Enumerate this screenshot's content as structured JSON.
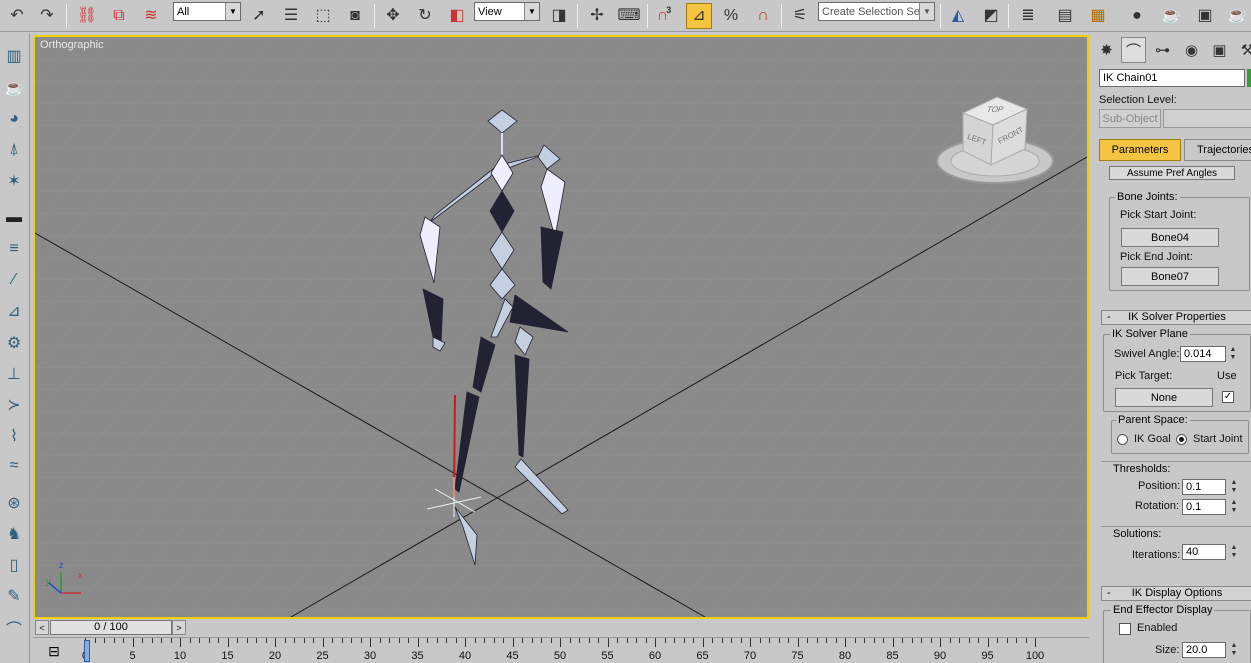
{
  "toolbar": {
    "selection_filter": "All",
    "reference_coord": "View",
    "snap_count": "3",
    "named_selection_placeholder": "Create Selection Set",
    "icons": [
      "undo-icon",
      "redo-icon",
      "select-and-link-icon",
      "unlink-icon",
      "bind-space-warp-icon",
      "select-object-icon",
      "select-by-name-icon",
      "rect-selection-icon",
      "window-crossing-icon",
      "move-icon",
      "rotate-icon",
      "scale-icon",
      "pivot-icon",
      "manipulate-icon",
      "keyboard-shortcut-icon",
      "snaps-toggle-icon",
      "angle-snap-icon",
      "percent-snap-icon",
      "spinner-snap-icon",
      "edit-named-selections-icon",
      "mirror-icon",
      "align-icon",
      "layer-manager-icon",
      "curve-editor-icon",
      "schematic-view-icon",
      "material-editor-icon",
      "render-setup-icon",
      "rendered-frame-icon",
      "render-icon"
    ]
  },
  "viewport": {
    "label": "Orthographic",
    "viewcube": {
      "top": "TOP",
      "left": "LEFT",
      "front": "FRONT"
    },
    "axis": {
      "x": "x",
      "y": "y",
      "z": "z"
    }
  },
  "timeline": {
    "slider_text": "0 / 100",
    "prev": "<",
    "next": ">",
    "ticks": [
      0,
      5,
      10,
      15,
      20,
      25,
      30,
      35,
      40,
      45,
      50,
      55,
      60,
      65,
      70,
      75,
      80,
      85,
      90,
      95,
      100
    ]
  },
  "panel": {
    "object_name": "IK Chain01",
    "object_color": "#3a9a3a",
    "selection_level_label": "Selection Level:",
    "subobject_button": "Sub-Object",
    "tabs": {
      "parameters": "Parameters",
      "trajectories": "Trajectories"
    },
    "assume_pref_angles": "Assume Pref Angles",
    "bone_joints": {
      "title": "Bone Joints:",
      "pick_start_label": "Pick Start Joint:",
      "start_joint": "Bone04",
      "pick_end_label": "Pick End Joint:",
      "end_joint": "Bone07"
    },
    "ik_solver": {
      "rollout_title": "IK Solver Properties",
      "minus": "-",
      "plane_title": "IK Solver Plane",
      "swivel_label": "Swivel Angle:",
      "swivel_value": "0.014",
      "pick_target_label": "Pick Target:",
      "use_label": "Use",
      "target_button": "None",
      "use_checked": "✓",
      "parent_space_title": "Parent Space:",
      "ik_goal": "IK Goal",
      "start_joint": "Start Joint",
      "thresholds_title": "Thresholds:",
      "position_label": "Position:",
      "position_value": "0.1",
      "rotation_label": "Rotation:",
      "rotation_value": "0.1",
      "solutions_title": "Solutions:",
      "iterations_label": "Iterations:",
      "iterations_value": "40"
    },
    "ik_display": {
      "rollout_title": "IK Display Options",
      "minus": "-",
      "end_effector_title": "End Effector Display",
      "enabled_label": "Enabled",
      "size_label": "Size:",
      "size_value": "20.0"
    }
  }
}
